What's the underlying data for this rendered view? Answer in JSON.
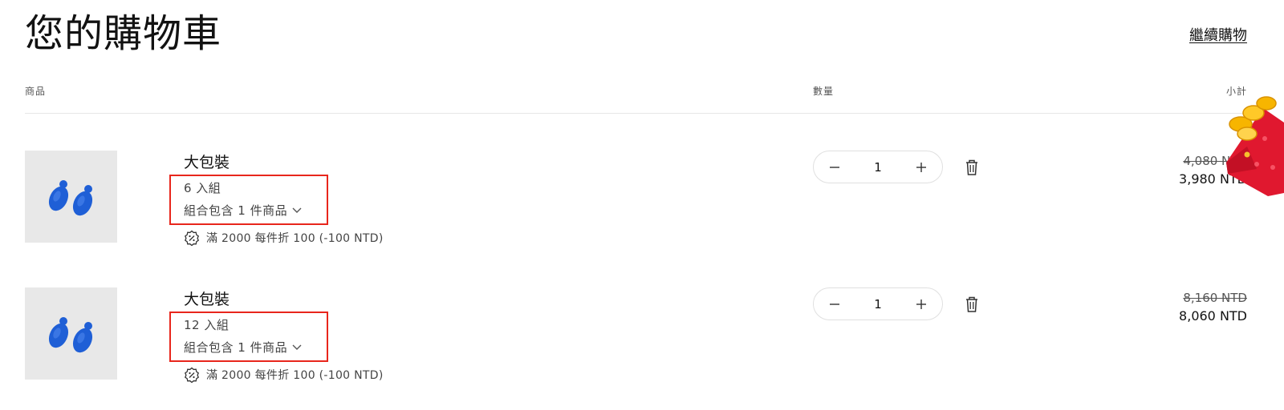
{
  "header": {
    "title": "您的購物車",
    "continue_label": "繼續購物"
  },
  "columns": {
    "product": "商品",
    "quantity": "數量",
    "subtotal": "小計"
  },
  "items": [
    {
      "name": "大包裝",
      "variant": "6 入組",
      "bundle_label": "組合包含 1 件商品",
      "discount": "滿 2000 每件折 100 (-100 NTD)",
      "quantity": "1",
      "price_original": "4,080 NTD",
      "price_current": "3,980 NTD"
    },
    {
      "name": "大包裝",
      "variant": "12 入組",
      "bundle_label": "組合包含 1 件商品",
      "discount": "滿 2000 每件折 100 (-100 NTD)",
      "quantity": "1",
      "price_original": "8,160 NTD",
      "price_current": "8,060 NTD"
    }
  ],
  "icons": {
    "decrease": "minus-icon",
    "increase": "plus-icon",
    "remove": "trash-icon",
    "expand": "chevron-down-icon",
    "discount": "discount-badge-icon",
    "promo": "red-envelope-icon"
  },
  "colors": {
    "highlight_border": "#e8261c",
    "earring_blue": "#1f5fd6",
    "thumbnail_bg": "#e8e8e8"
  }
}
